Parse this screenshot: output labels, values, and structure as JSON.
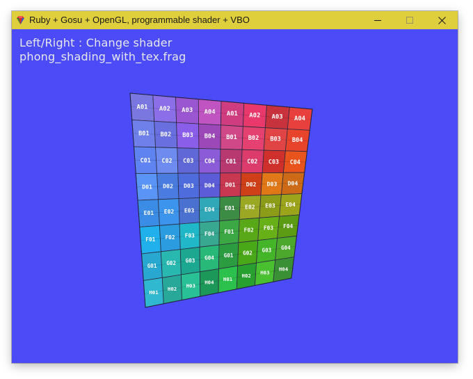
{
  "window": {
    "title": "Ruby + Gosu + OpenGL, programmable shader + VBO",
    "client_bg": "#4b4bf8",
    "titlebar_bg": "#e0cf3c"
  },
  "hud": {
    "line1": "Left/Right : Change shader",
    "line2": "phong_shading_with_tex.frag"
  },
  "texture_grid": {
    "rows": [
      "A",
      "B",
      "C",
      "D",
      "E",
      "F",
      "G",
      "H"
    ],
    "labels": [
      [
        "A01",
        "A02",
        "A03",
        "A04",
        "A01",
        "A02",
        "A03",
        "A04"
      ],
      [
        "B01",
        "B02",
        "B03",
        "B04",
        "B01",
        "B02",
        "B03",
        "B04"
      ],
      [
        "C01",
        "C02",
        "C03",
        "C04",
        "C01",
        "C02",
        "C03",
        "C04"
      ],
      [
        "D01",
        "D02",
        "D03",
        "D04",
        "D01",
        "D02",
        "D03",
        "D04"
      ],
      [
        "E01",
        "E02",
        "E03",
        "E04",
        "E01",
        "E02",
        "E03",
        "E04"
      ],
      [
        "F01",
        "F02",
        "F03",
        "F04",
        "F01",
        "F02",
        "F03",
        "F04"
      ],
      [
        "G01",
        "G02",
        "G03",
        "G04",
        "G01",
        "G02",
        "G03",
        "G04"
      ],
      [
        "H01",
        "H02",
        "H03",
        "H04",
        "H01",
        "H02",
        "H03",
        "H04"
      ]
    ],
    "colors": [
      [
        "#7a78e0",
        "#8a6fe8",
        "#9a55d0",
        "#c054c0",
        "#cf3c80",
        "#e9386a",
        "#c8323c",
        "#e8403c"
      ],
      [
        "#6f80ea",
        "#6a6fe0",
        "#8a5ee8",
        "#9c48b8",
        "#d04888",
        "#e44070",
        "#e04444",
        "#e8442c"
      ],
      [
        "#5f84f2",
        "#6e8cf0",
        "#6068d8",
        "#8a5cd8",
        "#b83870",
        "#dc3c6c",
        "#d0302c",
        "#e8541c"
      ],
      [
        "#5a94f4",
        "#4a7ce0",
        "#4e6cdc",
        "#5c5cd8",
        "#c83850",
        "#d04018",
        "#e07818",
        "#cc6a18"
      ],
      [
        "#3a8ce4",
        "#3c94ec",
        "#4a70d0",
        "#30a8b8",
        "#3c8c44",
        "#9aa824",
        "#8c9c18",
        "#9ca41c"
      ],
      [
        "#20b0ec",
        "#2c9ce0",
        "#20b8c8",
        "#38a890",
        "#3ca844",
        "#58a818",
        "#68b018",
        "#5c9c14"
      ],
      [
        "#28a8d0",
        "#28b8b0",
        "#1ca890",
        "#28b878",
        "#2c9c40",
        "#48a818",
        "#44b428",
        "#4ca82c"
      ],
      [
        "#30b8d0",
        "#28a898",
        "#28c094",
        "#1c9858",
        "#2cc04c",
        "#28a030",
        "#48c030",
        "#3a9034"
      ]
    ]
  }
}
